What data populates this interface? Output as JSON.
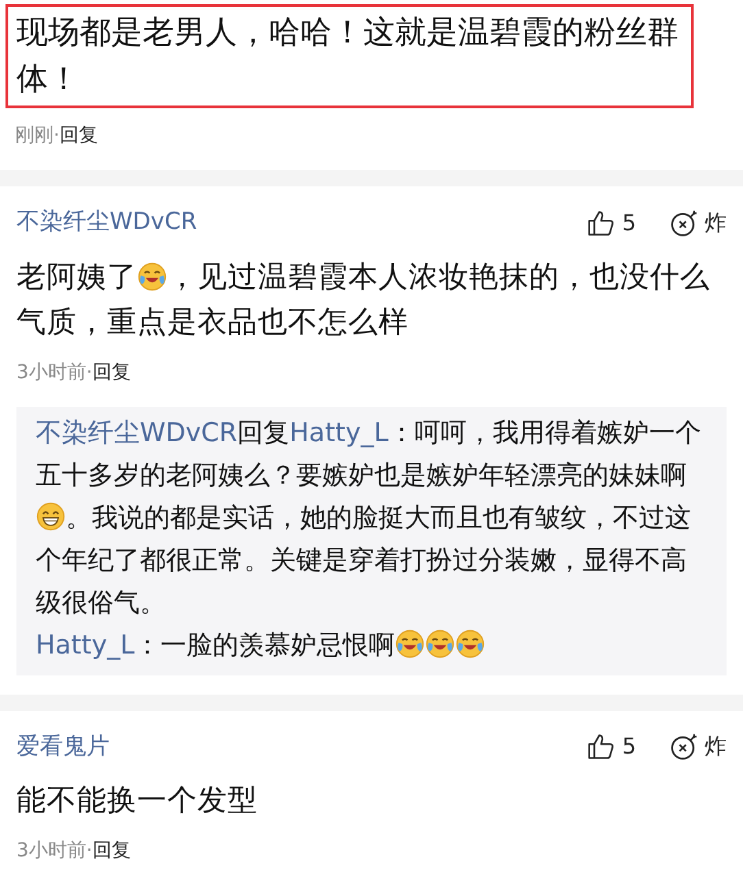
{
  "highlighted_comment": {
    "segments": [
      {
        "kind": "text",
        "text": "现场都是老男人，哈哈！这就是温碧霞的粉丝群体！"
      }
    ],
    "time": "刚刚",
    "separator": "·",
    "reply": "回复"
  },
  "comments": [
    {
      "user": "不染纤尘WDvCR",
      "likes": "5",
      "bomb": "炸",
      "segments": [
        {
          "kind": "text",
          "text": "老阿姨了"
        },
        {
          "kind": "tears"
        },
        {
          "kind": "text",
          "text": "，见过温碧霞本人浓妆艳抹的，也没什么气质，重点是衣品也不怎么样"
        }
      ],
      "time": "3小时前",
      "separator": "·",
      "reply": "回复",
      "replies": [
        {
          "user": "不染纤尘WDvCR",
          "reply_word": "回复",
          "to": "Hatty_L",
          "segments": [
            {
              "kind": "text",
              "text": "：呵呵，我用得着嫉妒一个五十多岁的老阿姨么？要嫉妒也是嫉妒年轻漂亮的妹妹啊"
            },
            {
              "kind": "grin"
            },
            {
              "kind": "text",
              "text": "。我说的都是实话，她的脸挺大而且也有皱纹，不过这个年纪了都很正常。关键是穿着打扮过分装嫩，显得不高级很俗气。"
            }
          ]
        },
        {
          "user": "Hatty_L",
          "segments": [
            {
              "kind": "text",
              "text": "：一脸的羡慕妒忌恨啊"
            },
            {
              "kind": "tears"
            },
            {
              "kind": "tears"
            },
            {
              "kind": "tears"
            }
          ]
        }
      ]
    },
    {
      "user": "爱看鬼片",
      "likes": "5",
      "bomb": "炸",
      "segments": [
        {
          "kind": "text",
          "text": "能不能换一个发型"
        }
      ],
      "time": "3小时前",
      "separator": "·",
      "reply": "回复"
    }
  ]
}
